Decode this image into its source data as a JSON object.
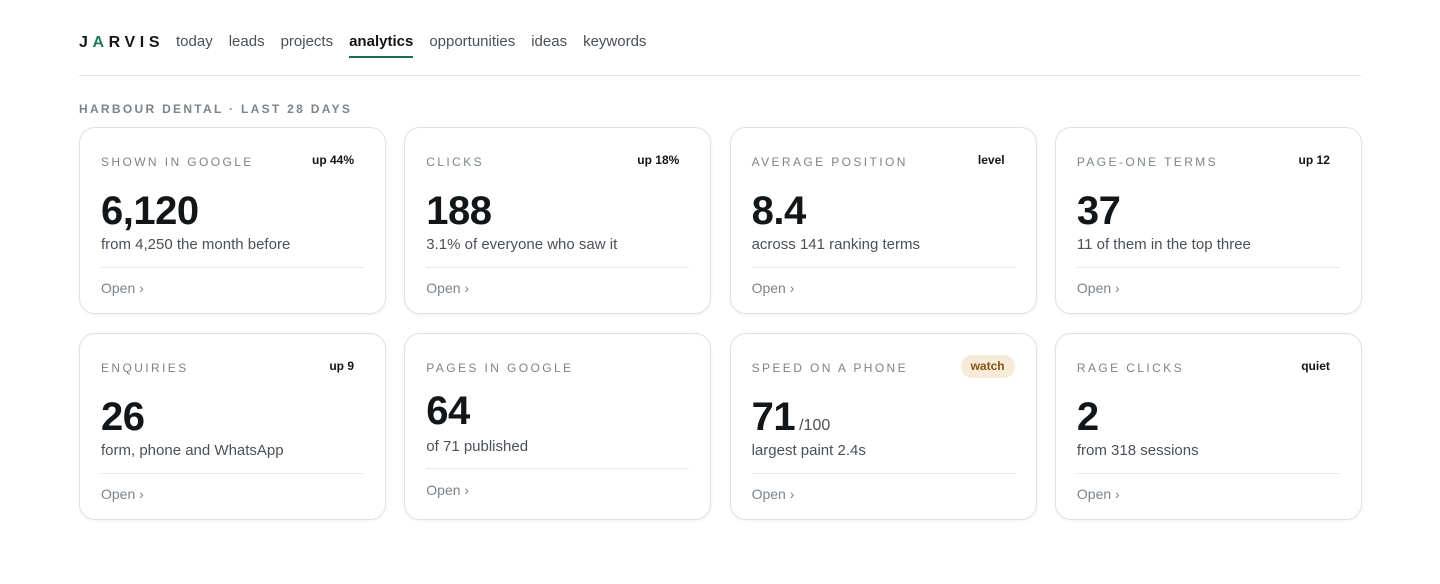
{
  "app": {
    "logo_prefix": "J",
    "logo_accent": "A",
    "logo_suffix": "RVIS"
  },
  "nav": {
    "items": [
      "today",
      "leads",
      "projects",
      "analytics",
      "opportunities",
      "ideas",
      "keywords"
    ],
    "active": "analytics"
  },
  "section": {
    "label": "HARBOUR DENTAL · LAST 28 DAYS"
  },
  "cards": [
    {
      "label": "SHOWN IN GOOGLE",
      "trend": "up 44%",
      "value": "6,120",
      "unit": "",
      "sub": "from 4,250 the month before",
      "open": "Open ›"
    },
    {
      "label": "CLICKS",
      "trend": "up 18%",
      "value": "188",
      "unit": "",
      "sub": "3.1% of everyone who saw it",
      "open": "Open ›"
    },
    {
      "label": "AVERAGE POSITION",
      "trend": "level",
      "value": "8.4",
      "unit": "",
      "sub": "across 141 ranking terms",
      "open": "Open ›"
    },
    {
      "label": "PAGE-ONE TERMS",
      "trend": "up 12",
      "value": "37",
      "unit": "",
      "sub": "11 of them in the top three",
      "open": "Open ›"
    },
    {
      "label": "ENQUIRIES",
      "trend": "up 9",
      "value": "26",
      "unit": "",
      "sub": "form, phone and WhatsApp",
      "open": "Open ›"
    },
    {
      "label": "PAGES IN GOOGLE",
      "trend": "",
      "value": "64",
      "unit": "",
      "sub": "of 71 published",
      "open": "Open ›"
    },
    {
      "label": "SPEED ON A PHONE",
      "trend": "watch",
      "value": "71",
      "unit": "/100",
      "sub": "largest paint 2.4s",
      "open": "Open ›"
    },
    {
      "label": "RAGE CLICKS",
      "trend": "quiet",
      "value": "2",
      "unit": "",
      "sub": "from 318 sessions",
      "open": "Open ›"
    }
  ],
  "colors": {
    "brand_accent": "#1f7a55",
    "watch_badge_bg": "#f6ead8",
    "watch_badge_text": "#8a5312"
  }
}
